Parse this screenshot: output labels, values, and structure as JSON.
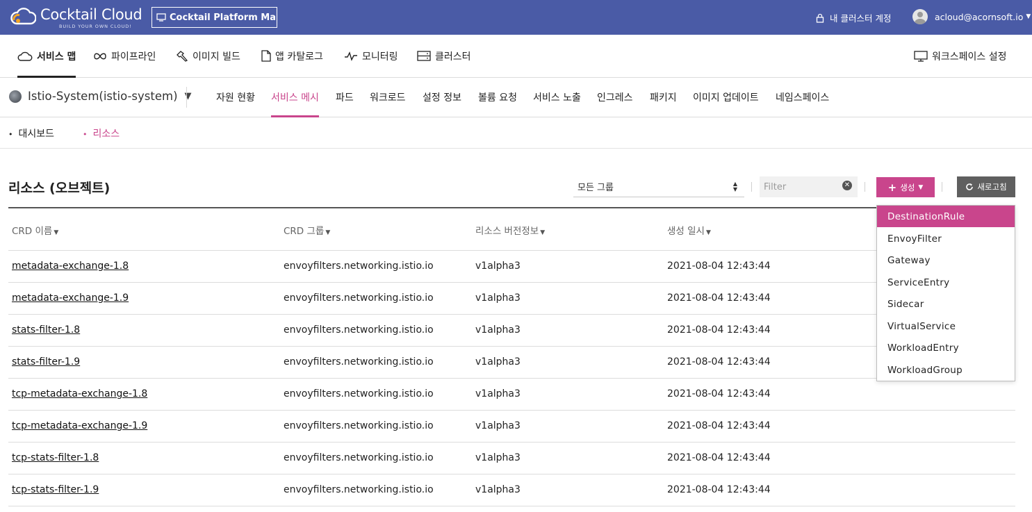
{
  "header": {
    "brand": "Cocktail Cloud",
    "tagline": "BUILD YOUR OWN CLOUD!",
    "platform_select": "Cocktail Platform Ma···",
    "account_link": "내 클러스터 계정",
    "user_email": "acloud@acornsoft.io",
    "brand_color": "#4a5ba6"
  },
  "main_nav": {
    "items": [
      {
        "label": "서비스 맵",
        "icon": "cloud-icon",
        "active": true
      },
      {
        "label": "파이프라인",
        "icon": "infinity-icon"
      },
      {
        "label": "이미지 빌드",
        "icon": "hammer-icon"
      },
      {
        "label": "앱 카탈로그",
        "icon": "document-icon"
      },
      {
        "label": "모니터링",
        "icon": "pulse-icon"
      },
      {
        "label": "클러스터",
        "icon": "server-icon"
      }
    ],
    "workspace_settings": {
      "label": "워크스페이스 설정",
      "icon": "monitor-icon"
    }
  },
  "sub_nav": {
    "namespace": "Istio-System(istio-system)",
    "items": [
      "자원 현황",
      "서비스 메시",
      "파드",
      "워크로드",
      "설정 정보",
      "볼륨 요청",
      "서비스 노출",
      "인그레스",
      "패키지",
      "이미지 업데이트",
      "네임스페이스"
    ],
    "active": "서비스 메시",
    "accent_color": "#c9458c"
  },
  "tabs": {
    "items": [
      "대시보드",
      "리소스"
    ],
    "active": "리소스"
  },
  "panel": {
    "title": "리소스 (오브젝트)",
    "group_select": "모든 그룹",
    "filter_placeholder": "Filter",
    "create_label": "생성",
    "refresh_label": "새로고침"
  },
  "table": {
    "columns": [
      "CRD 이름",
      "CRD 그룹",
      "리소스 버전정보",
      "생성 일시"
    ],
    "rows": [
      [
        "metadata-exchange-1.8",
        "envoyfilters.networking.istio.io",
        "v1alpha3",
        "2021-08-04 12:43:44"
      ],
      [
        "metadata-exchange-1.9",
        "envoyfilters.networking.istio.io",
        "v1alpha3",
        "2021-08-04 12:43:44"
      ],
      [
        "stats-filter-1.8",
        "envoyfilters.networking.istio.io",
        "v1alpha3",
        "2021-08-04 12:43:44"
      ],
      [
        "stats-filter-1.9",
        "envoyfilters.networking.istio.io",
        "v1alpha3",
        "2021-08-04 12:43:44"
      ],
      [
        "tcp-metadata-exchange-1.8",
        "envoyfilters.networking.istio.io",
        "v1alpha3",
        "2021-08-04 12:43:44"
      ],
      [
        "tcp-metadata-exchange-1.9",
        "envoyfilters.networking.istio.io",
        "v1alpha3",
        "2021-08-04 12:43:44"
      ],
      [
        "tcp-stats-filter-1.8",
        "envoyfilters.networking.istio.io",
        "v1alpha3",
        "2021-08-04 12:43:44"
      ],
      [
        "tcp-stats-filter-1.9",
        "envoyfilters.networking.istio.io",
        "v1alpha3",
        "2021-08-04 12:43:44"
      ]
    ]
  },
  "create_menu": {
    "items": [
      "DestinationRule",
      "EnvoyFilter",
      "Gateway",
      "ServiceEntry",
      "Sidecar",
      "VirtualService",
      "WorkloadEntry",
      "WorkloadGroup"
    ],
    "highlighted": "DestinationRule"
  }
}
